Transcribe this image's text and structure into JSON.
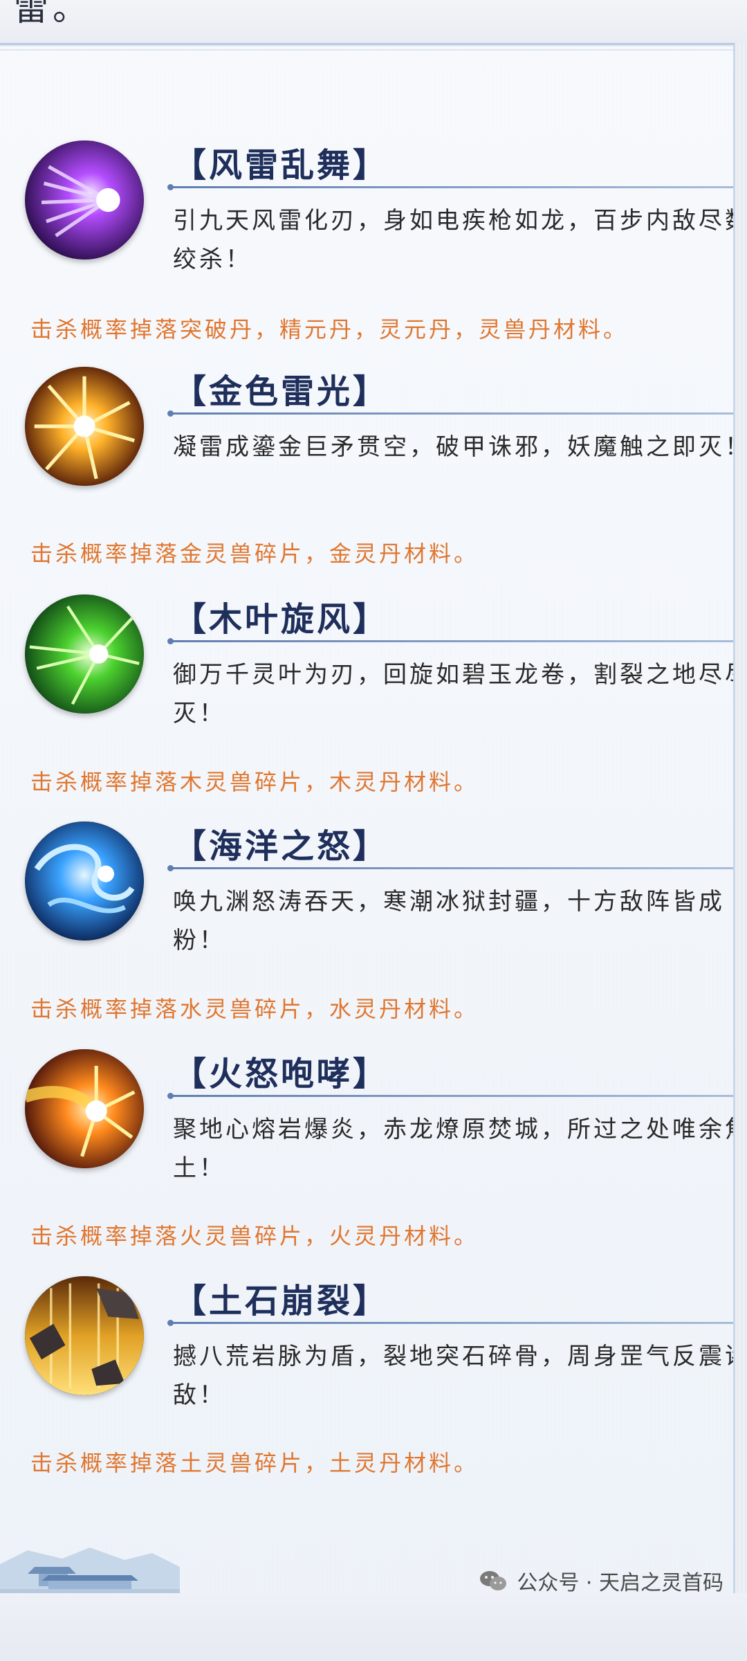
{
  "header": {
    "fragment_text": "雷。"
  },
  "skills": [
    {
      "title": "【风雷乱舞】",
      "desc": "引九天风雷化刃，身如电疾枪如龙，百步内敌尽数绞杀！",
      "drop": "击杀概率掉落突破丹，精元丹，灵元丹，灵兽丹材料。",
      "icon": "purple-wind-thunder-icon",
      "color": "#7b2bd6"
    },
    {
      "title": "【金色雷光】",
      "desc": "凝雷成鎏金巨矛贯空，破甲诛邪，妖魔触之即灭！",
      "drop": "击杀概率掉落金灵兽碎片，金灵丹材料。",
      "icon": "golden-lightning-icon",
      "color": "#d47a14"
    },
    {
      "title": "【木叶旋风】",
      "desc": "御万千灵叶为刃，回旋如碧玉龙卷，割裂之地尽尽灭！",
      "drop": "击杀概率掉落木灵兽碎片，木灵丹材料。",
      "icon": "green-leaf-whirlwind-icon",
      "color": "#2fae3a"
    },
    {
      "title": "【海洋之怒】",
      "desc": "唤九渊怒涛吞天，寒潮冰狱封疆，十方敌阵皆成粉！",
      "drop": "击杀概率掉落水灵兽碎片，水灵丹材料。",
      "icon": "ocean-wave-icon",
      "color": "#1f6fd6"
    },
    {
      "title": "【火怒咆哮】",
      "desc": "聚地心熔岩爆炎，赤龙燎原焚城，所过之处唯余焦土！",
      "drop": "击杀概率掉落火灵兽碎片，火灵丹材料。",
      "icon": "fire-roar-icon",
      "color": "#e0551a"
    },
    {
      "title": "【土石崩裂】",
      "desc": "撼八荒岩脉为盾，裂地突石碎骨，周身罡气反震诸敌！",
      "drop": "击杀概率掉落土灵兽碎片，土灵丹材料。",
      "icon": "earth-rock-icon",
      "color": "#d59a1d"
    }
  ],
  "watermark": {
    "text": "公众号 · 天启之灵首码",
    "icon": "wechat-icon"
  }
}
